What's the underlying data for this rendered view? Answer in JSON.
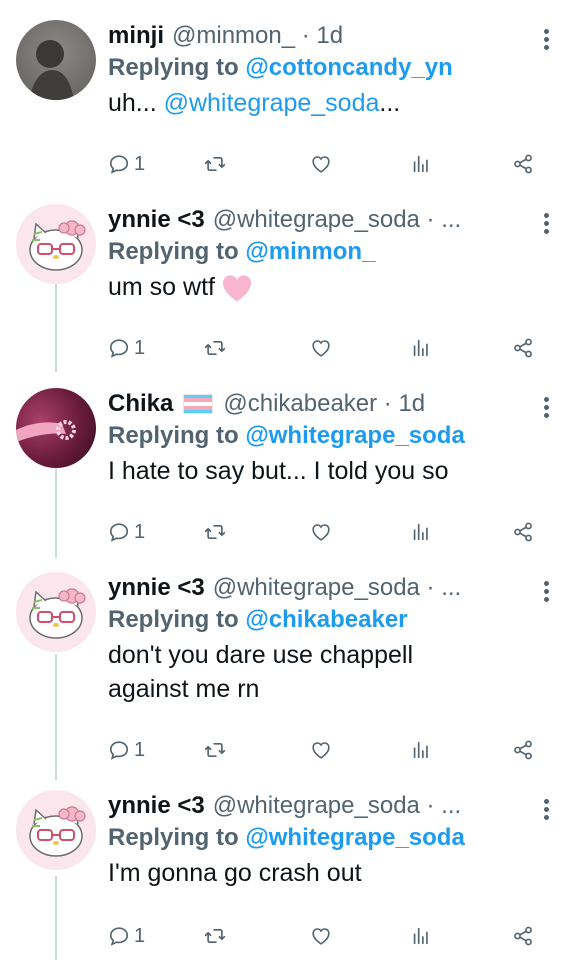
{
  "posts": [
    {
      "name": "minji",
      "handle": "@minmon_ · 1d",
      "reply_prefix": "Replying to",
      "reply_to": "@cottoncandy_yn",
      "text_prefix": "uh... ",
      "text_mention": "@whitegrape_soda",
      "text_suffix": "...",
      "reply_count": "1",
      "avatar_icon": "profile-photo-dark"
    },
    {
      "name": "ynnie <3",
      "handle": "@whitegrape_soda · ...",
      "reply_prefix": "Replying to",
      "reply_to": "@minmon_",
      "text": "um so wtf",
      "emoji": "pink-heart-emoji",
      "reply_count": "1",
      "avatar_icon": "hello-kitty-avatar"
    },
    {
      "name": "Chika",
      "flag_icon": "transgender-flag",
      "handle": "@chikabeaker · 1d",
      "reply_prefix": "Replying to",
      "reply_to": "@whitegrape_soda",
      "text": "I hate to say but... I told you so",
      "reply_count": "1",
      "avatar_icon": "profile-photo-pink"
    },
    {
      "name": "ynnie <3",
      "handle": "@whitegrape_soda · ...",
      "reply_prefix": "Replying to",
      "reply_to": "@chikabeaker",
      "text_line1": "don't you dare use chappell",
      "text_line2": "against me rn",
      "reply_count": "1",
      "avatar_icon": "hello-kitty-avatar"
    },
    {
      "name": "ynnie <3",
      "handle": "@whitegrape_soda · ...",
      "reply_prefix": "Replying to",
      "reply_to": "@whitegrape_soda",
      "text": "I'm gonna go crash out",
      "reply_count": "1",
      "avatar_icon": "hello-kitty-avatar"
    }
  ],
  "colors": {
    "accent": "#1d9bf0",
    "muted": "#536471",
    "text": "#0f1419"
  }
}
